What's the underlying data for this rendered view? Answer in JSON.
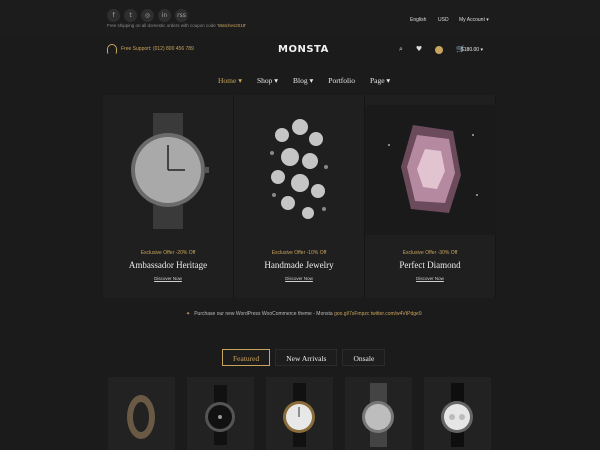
{
  "topbar": {
    "social": [
      "f",
      "t",
      "◎",
      "in",
      "rss"
    ],
    "free_shipping_text": "Free shipping on all domestic orders with coupon code ",
    "coupon_code": "'Watches2018'",
    "language": "English",
    "currency": "USD",
    "account": "My Account"
  },
  "header": {
    "support": "Free Support: (012) 800 456 789",
    "logo": "MONSTA",
    "cart_total": "$180.00"
  },
  "nav": {
    "items": [
      {
        "label": "Home",
        "has_dropdown": true
      },
      {
        "label": "Shop",
        "has_dropdown": true
      },
      {
        "label": "Blog",
        "has_dropdown": true
      },
      {
        "label": "Portfolio",
        "has_dropdown": false
      },
      {
        "label": "Page",
        "has_dropdown": true
      }
    ],
    "active": "Home"
  },
  "hero": {
    "panels": [
      {
        "offer": "Exclusive Offer -20% Off",
        "title": "Ambassador Heritage",
        "cta": "Discover Now"
      },
      {
        "offer": "Exclusive Offer -10% Off",
        "title": "Handmade Jewelry",
        "cta": "Discover Now"
      },
      {
        "offer": "Exclusive Offer -30% Off",
        "title": "Perfect Diamond",
        "cta": "Discover Now"
      }
    ]
  },
  "tweet": {
    "text": "Purchase our new WordPress WooCommerce theme - Monsta ",
    "link": "goo.gl/7sFmpzc twitter.com/w4VtPdge9"
  },
  "tabs": [
    "Featured",
    "New Arrivals",
    "Onsale"
  ],
  "active_tab": "Featured",
  "colors": {
    "accent": "#c9a45c",
    "background": "#1b1b1b",
    "panel": "#1f1f1f"
  }
}
